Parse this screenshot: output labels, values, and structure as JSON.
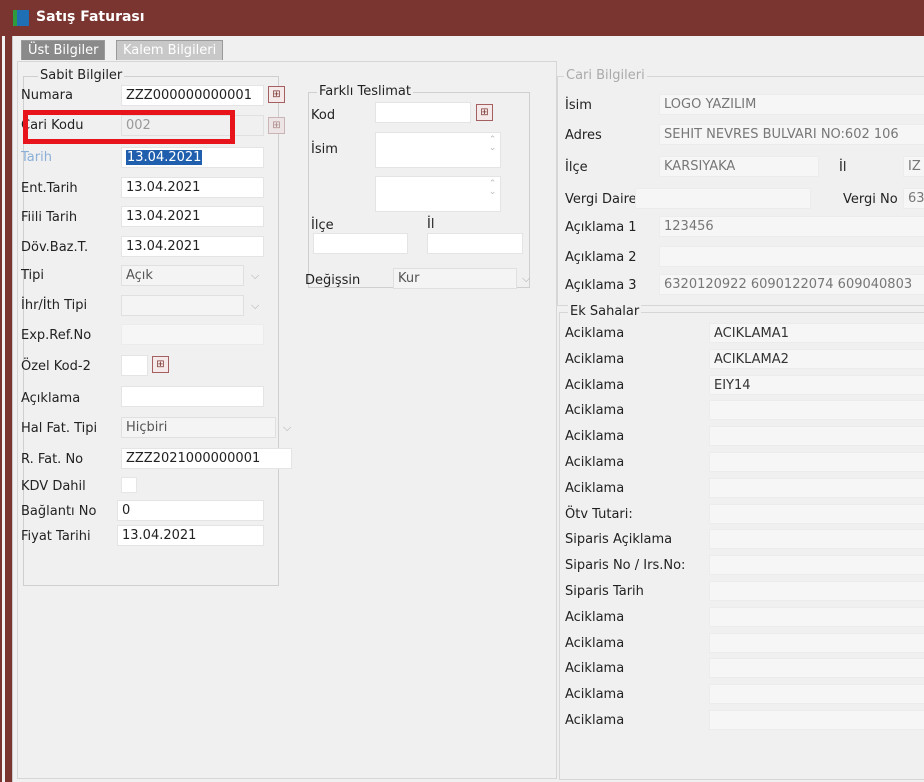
{
  "window": {
    "title": "Satış Faturası",
    "tabs": [
      {
        "label": "Üst Bilgiler",
        "active": true
      },
      {
        "label": "Kalem Bilgileri",
        "active": false
      }
    ]
  },
  "sabit": {
    "legend": "Sabit Bilgiler",
    "numara_label": "Numara",
    "numara_value": "ZZZ000000000001",
    "cari_kodu_label": "Cari Kodu",
    "cari_kodu_value": "002",
    "tarih_label": "Tarih",
    "tarih_value": "13.04.2021",
    "ent_tarih_label": "Ent.Tarih",
    "ent_tarih_value": "13.04.2021",
    "fiili_tarih_label": "Fiili Tarih",
    "fiili_tarih_value": "13.04.2021",
    "dov_baz_label": "Döv.Baz.T.",
    "dov_baz_value": "13.04.2021",
    "tipi_label": "Tipi",
    "tipi_value": "Açık",
    "ihr_label": "İhr/İth Tipi",
    "ihr_value": "",
    "exp_label": "Exp.Ref.No",
    "exp_value": "",
    "ozel_kod_label": "Özel Kod-2",
    "ozel_kod_value": "",
    "aciklama_label": "Açıklama",
    "aciklama_value": "",
    "hal_fat_label": "Hal Fat. Tipi",
    "hal_fat_value": "Hiçbiri",
    "r_fat_label": "R. Fat. No",
    "r_fat_value": "ZZZ2021000000001",
    "kdv_label": "KDV Dahil",
    "baglanti_label": "Bağlantı No",
    "baglanti_value": "0",
    "fiyat_tarihi_label": "Fiyat Tarihi",
    "fiyat_tarihi_value": "13.04.2021"
  },
  "farkli": {
    "legend": "Farklı Teslimat",
    "kod_label": "Kod",
    "kod_value": "",
    "isim_label": "İsim",
    "ilce_label": "İlçe",
    "il_label": "İl",
    "degissin_label": "Değişsin",
    "degissin_value": "Kur"
  },
  "cari": {
    "legend": "Cari Bilgileri",
    "isim_label": "İsim",
    "isim_value": "LOGO YAZILIM",
    "adres_label": "Adres",
    "adres_value": "SEHIT NEVRES BULVARI NO:602 106",
    "ilce_label": "İlçe",
    "ilce_value": "KARSIYAKA",
    "il_label": "İl",
    "il_value": "IZ",
    "vergi_dairesi_label": "Vergi Dairesi",
    "vergi_dairesi_value": "",
    "vergi_no_label": "Vergi No",
    "vergi_no_value": "63",
    "aciklama1_label": "Açıklama 1",
    "aciklama1_value": "123456",
    "aciklama2_label": "Açıklama 2",
    "aciklama2_value": "",
    "aciklama3_label": "Açıklama 3",
    "aciklama3_value": "6320120922 6090122074 609040803"
  },
  "ek": {
    "legend": "Ek Sahalar",
    "rows": [
      {
        "label": "Aciklama",
        "value": "ACIKLAMA1"
      },
      {
        "label": "Aciklama",
        "value": "ACIKLAMA2"
      },
      {
        "label": "Aciklama",
        "value": "EIY14"
      },
      {
        "label": "Aciklama",
        "value": ""
      },
      {
        "label": "Aciklama",
        "value": ""
      },
      {
        "label": "Aciklama",
        "value": ""
      },
      {
        "label": "Aciklama",
        "value": ""
      },
      {
        "label": "Ötv Tutari:",
        "value": ""
      },
      {
        "label": "Siparis Açiklama",
        "value": ""
      },
      {
        "label": "Siparis No / Irs.No:",
        "value": ""
      },
      {
        "label": "Siparis Tarih",
        "value": ""
      },
      {
        "label": "Aciklama",
        "value": ""
      },
      {
        "label": "Aciklama",
        "value": ""
      },
      {
        "label": "Aciklama",
        "value": ""
      },
      {
        "label": "Aciklama",
        "value": ""
      },
      {
        "label": "Aciklama",
        "value": ""
      }
    ]
  },
  "colors": {
    "titlebar": "#7a3530",
    "selection": "#1f5fae",
    "highlight_box": "#e8141b"
  }
}
